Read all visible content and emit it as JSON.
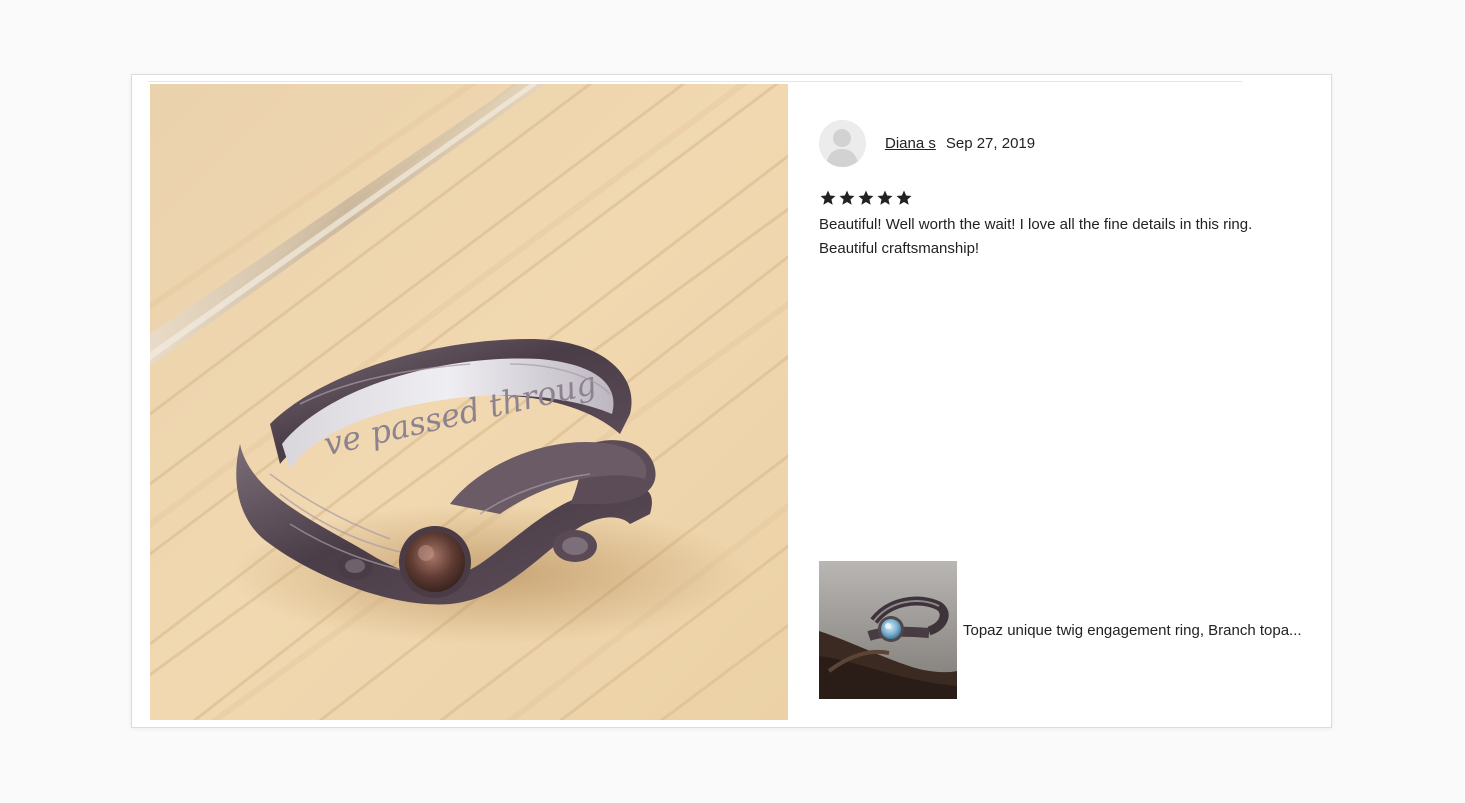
{
  "review": {
    "reviewer_name": "Diana s",
    "date": "Sep 27, 2019",
    "rating": 5,
    "rating_max": 5,
    "text": "Beautiful! Well worth the wait! I love all the fine details in this ring. Beautiful craftsmanship!"
  },
  "purchased_item": {
    "title": "Topaz unique twig engagement ring, Branch topa..."
  },
  "photo": {
    "engraving_text": "ve passed throug"
  },
  "icons": {
    "avatar": "person-silhouette-icon",
    "star": "star-filled-icon"
  },
  "colors": {
    "star": "#222222",
    "wood": "#efd3a8",
    "text": "#222222"
  }
}
